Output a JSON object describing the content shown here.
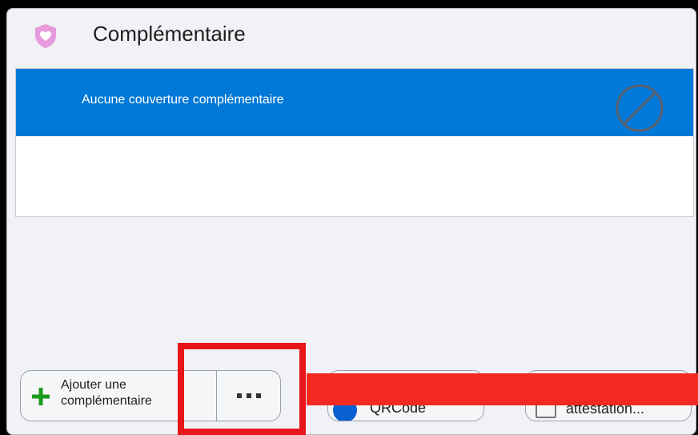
{
  "panel": {
    "title": "Complémentaire",
    "shield_icon": "shield-heart-icon",
    "accent_color": "#e89bdc"
  },
  "list": {
    "selected_row": {
      "label": "Aucune couverture complémentaire",
      "icon": "prohibited-icon",
      "background": "#0078d7"
    }
  },
  "buttons": {
    "add": {
      "label_line1": "Ajouter une",
      "label_line2": "complémentaire",
      "icon": "plus-icon"
    },
    "more": {
      "icon": "ellipsis-icon"
    },
    "qr": {
      "label": "QRCode",
      "icon": "qr-info-icon"
    },
    "attestation": {
      "label": "attestation...",
      "icon": "card-icon"
    }
  },
  "annotations": {
    "highlight_color": "#e8151b",
    "bar_color": "#f42a22"
  }
}
